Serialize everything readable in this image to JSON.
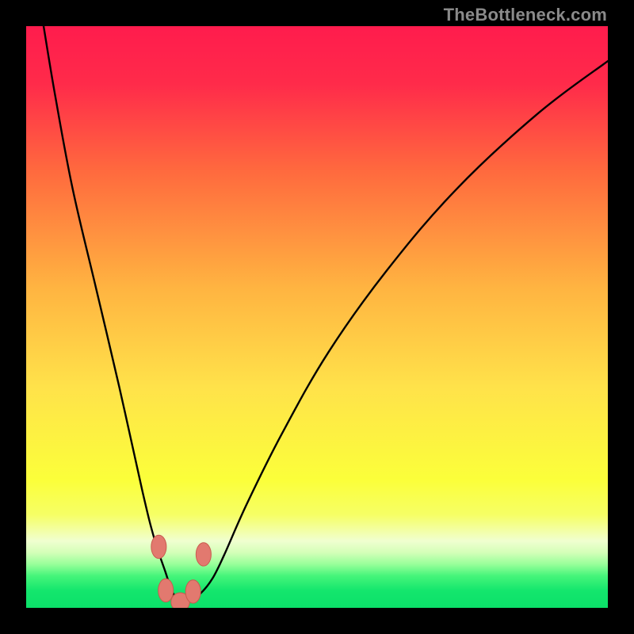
{
  "watermark": "TheBottleneck.com",
  "colors": {
    "black": "#000000",
    "gradient_stops": [
      {
        "offset": 0.0,
        "color": "#ff1c4d"
      },
      {
        "offset": 0.1,
        "color": "#ff2b4a"
      },
      {
        "offset": 0.25,
        "color": "#ff6a3e"
      },
      {
        "offset": 0.45,
        "color": "#ffb441"
      },
      {
        "offset": 0.62,
        "color": "#ffe24a"
      },
      {
        "offset": 0.78,
        "color": "#fbff3a"
      },
      {
        "offset": 0.84,
        "color": "#f6ff65"
      },
      {
        "offset": 0.865,
        "color": "#f3ffa0"
      },
      {
        "offset": 0.885,
        "color": "#f0ffd0"
      },
      {
        "offset": 0.905,
        "color": "#d4ffb8"
      },
      {
        "offset": 0.925,
        "color": "#98ff9a"
      },
      {
        "offset": 0.945,
        "color": "#46f57a"
      },
      {
        "offset": 0.97,
        "color": "#14e66d"
      },
      {
        "offset": 1.0,
        "color": "#0be069"
      }
    ],
    "curve_stroke": "#000000",
    "bead_fill": "#e2796f",
    "bead_stroke": "#c95b4f"
  },
  "chart_data": {
    "type": "line",
    "title": "",
    "xlabel": "",
    "ylabel": "",
    "xlim": [
      0,
      100
    ],
    "ylim": [
      0,
      100
    ],
    "grid": false,
    "series": [
      {
        "name": "bottleneck-curve",
        "x": [
          3,
          5,
          8,
          12,
          16,
          20,
          22,
          24,
          25,
          26,
          27,
          28,
          30,
          32,
          34,
          38,
          44,
          52,
          62,
          74,
          88,
          100
        ],
        "y": [
          100,
          88,
          72,
          55,
          38,
          20,
          12,
          6,
          3,
          1.5,
          1,
          1.2,
          2.5,
          5,
          9,
          18,
          30,
          44,
          58,
          72,
          85,
          94
        ]
      }
    ],
    "markers": [
      {
        "x": 22.8,
        "y": 10.5,
        "rx": 1.3,
        "ry": 2.0
      },
      {
        "x": 24.0,
        "y": 3.0,
        "rx": 1.3,
        "ry": 2.0
      },
      {
        "x": 26.5,
        "y": 1.0,
        "rx": 1.6,
        "ry": 1.6
      },
      {
        "x": 28.7,
        "y": 2.8,
        "rx": 1.3,
        "ry": 2.0
      },
      {
        "x": 30.5,
        "y": 9.2,
        "rx": 1.3,
        "ry": 2.0
      }
    ],
    "notch_y_fraction": 0.0,
    "description": "V-shaped bottleneck curve on a red-to-green vertical gradient; minimum near x≈26.5% with small salmon-colored beads around the dip."
  }
}
